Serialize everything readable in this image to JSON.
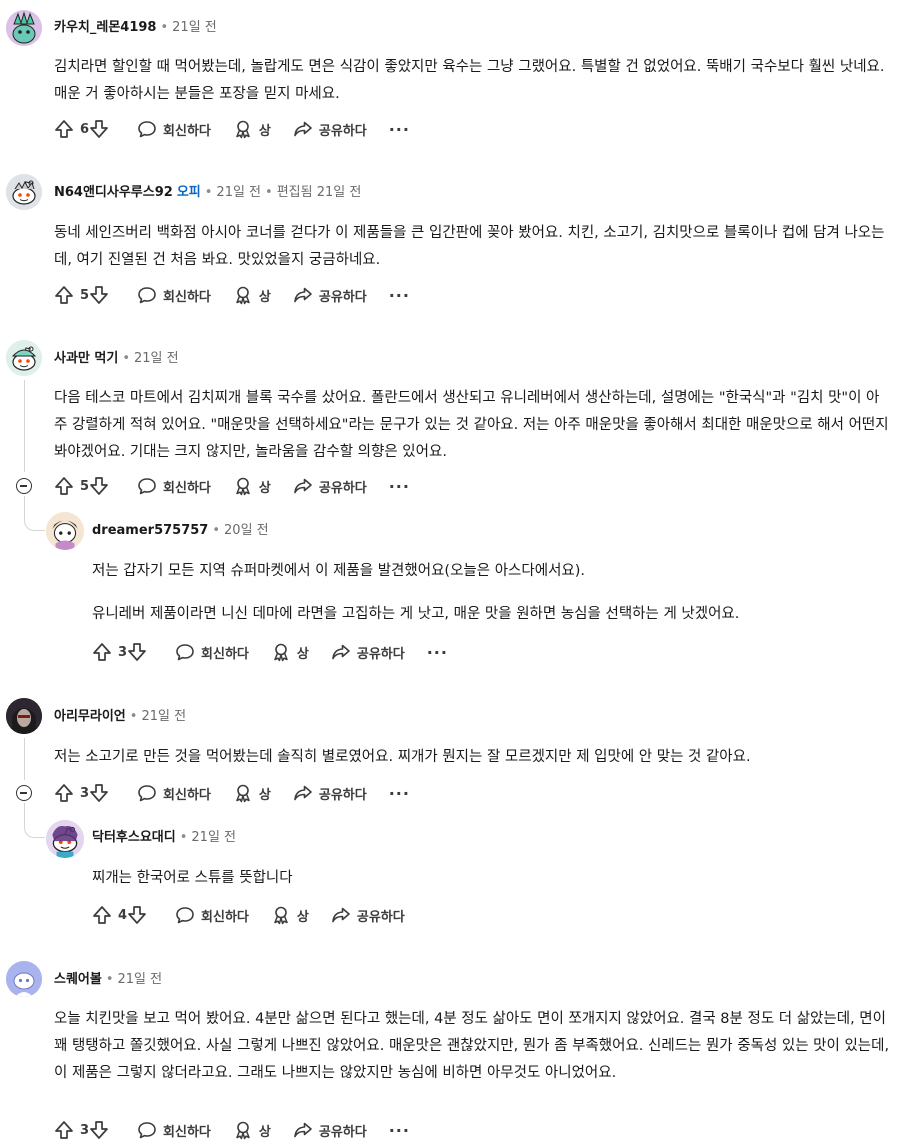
{
  "comments": [
    {
      "author": "카우치_레몬4198",
      "time": "21일 전",
      "body": [
        "김치라면 할인할 때 먹어봤는데, 놀랍게도 면은 식감이 좋았지만 육수는 그냥 그랬어요. 특별할 건 없었어요. 뚝배기 국수보다 훨씬 낫네요. 매운 거 좋아하시는 분들은 포장을 믿지 마세요."
      ],
      "votes": "6"
    },
    {
      "author": "N64앤디사우루스92",
      "op": "오피",
      "time": "21일 전",
      "edited": "편집됨 21일 전",
      "body": [
        "동네 세인즈버리 백화점 아시아 코너를 걷다가 이 제품들을 큰 입간판에 꽂아 봤어요. 치킨, 소고기, 김치맛으로 블록이나 컵에 담겨 나오는데, 여기 진열된 건 처음 봐요. 맛있었을지 궁금하네요."
      ],
      "votes": "5"
    },
    {
      "author": "사과만 먹기",
      "time": "21일 전",
      "body": [
        "다음 테스코 마트에서 김치찌개 블록 국수를 샀어요. 폴란드에서 생산되고 유니레버에서 생산하는데, 설명에는 \"한국식\"과 \"김치 맛\"이 아주 강렬하게 적혀 있어요. \"매운맛을 선택하세요\"라는 문구가 있는 것 같아요. 저는 아주 매운맛을 좋아해서 최대한 매운맛으로 해서 어떤지 봐야겠어요. 기대는 크지 않지만, 놀라움을 감수할 의향은 있어요."
      ],
      "votes": "5"
    },
    {
      "author": "dreamer575757",
      "time": "20일 전",
      "body": [
        "저는 갑자기 모든 지역 슈퍼마켓에서 이 제품을 발견했어요(오늘은 아스다에서요).",
        "유니레버 제품이라면 니신 데마에 라면을 고집하는 게 낫고, 매운 맛을 원하면 농심을 선택하는 게 낫겠어요."
      ],
      "votes": "3"
    },
    {
      "author": "아리무라이언",
      "time": "21일 전",
      "body": [
        "저는 소고기로 만든 것을 먹어봤는데 솔직히 별로였어요. 찌개가 뭔지는 잘 모르겠지만 제 입맛에 안 맞는 것 같아요."
      ],
      "votes": "3"
    },
    {
      "author": "닥터후스요대디",
      "time": "21일 전",
      "body": [
        "찌개는 한국어로 스튜를 뜻합니다"
      ],
      "votes": "4"
    },
    {
      "author": "스퀘어볼",
      "time": "21일 전",
      "body": [
        "오늘 치킨맛을 보고 먹어 봤어요. 4분만 삶으면 된다고 했는데, 4분 정도 삶아도 면이 쪼개지지 않았어요. 결국 8분 정도 더 삶았는데, 면이 꽤 탱탱하고 쫄깃했어요. 사실 그렇게 나쁘진 않았어요. 매운맛은 괜찮았지만, 뭔가 좀 부족했어요. 신레드는 뭔가 중독성 있는 맛이 있는데, 이 제품은 그렇지 않더라고요. 그래도 나쁘지는 않았지만 농심에 비하면 아무것도 아니었어요."
      ],
      "votes": "3"
    }
  ],
  "labels": {
    "reply": "회신하다",
    "award": "상",
    "share": "공유하다",
    "more": "···",
    "dot": "•"
  },
  "icons": [
    "upvote-icon",
    "downvote-icon",
    "reply-icon",
    "award-icon",
    "share-icon",
    "collapse-icon",
    "more-icon"
  ]
}
